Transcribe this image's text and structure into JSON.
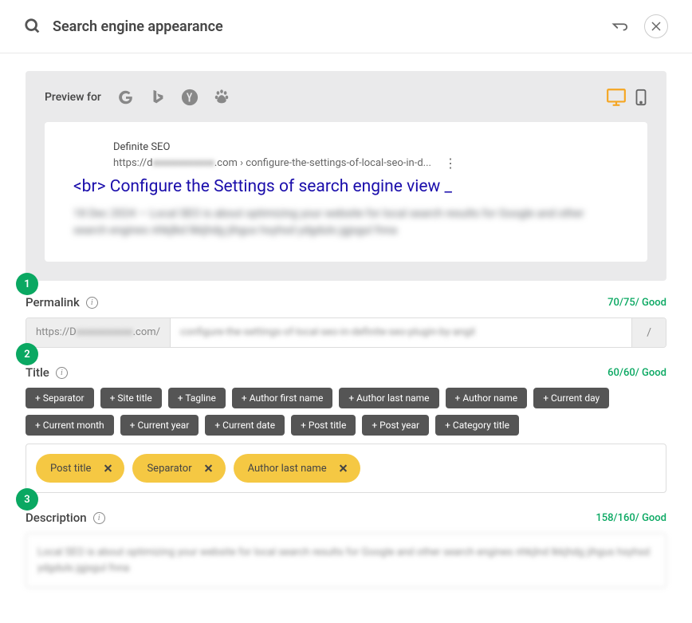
{
  "header": {
    "title": "Search engine appearance"
  },
  "preview": {
    "label": "Preview for",
    "site": "Definite SEO",
    "url_prefix": "https://d",
    "url_blur": "xxxxxxxxxxxx",
    "url_suffix": ".com  ›  configure-the-settings-of-local-seo-in-d...",
    "title": "<br> Configure the Settings of search engine view _",
    "desc": "18 Dec 2024 — Local SEO is about optimizing your website for local search results for Google and other search engines nhkjlkd lkkjhdg jihgus hsyhsd ydgduls jgjsgul fnna"
  },
  "permalink": {
    "step": "1",
    "label": "Permalink",
    "counter": "70/75/ Good",
    "prefix_pre": "https://D",
    "prefix_blur": "xxxxxxxxxxx",
    "prefix_post": ".com/",
    "value": "configure-the-settings-of-local-seo-in-definite-seo-plugin-by-angil",
    "suffix": "/"
  },
  "title": {
    "step": "2",
    "label": "Title",
    "counter": "60/60/ Good",
    "tags": [
      "+ Separator",
      "+ Site title",
      "+ Tagline",
      "+ Author first name",
      "+ Author last name",
      "+ Author name",
      "+ Current day",
      "+ Current month",
      "+ Current year",
      "+ Current date",
      "+ Post title",
      "+ Post year",
      "+ Category title"
    ],
    "selected": [
      "Post title",
      "Separator",
      "Author last name"
    ]
  },
  "description": {
    "step": "3",
    "label": "Description",
    "counter": "158/160/ Good",
    "value": "Local SEO is about optimizing your website for local search results for Google and other search engines nhkjlnd lkkjhdg jihgus hsyhsd ydgduls jgjsgul fnna"
  }
}
